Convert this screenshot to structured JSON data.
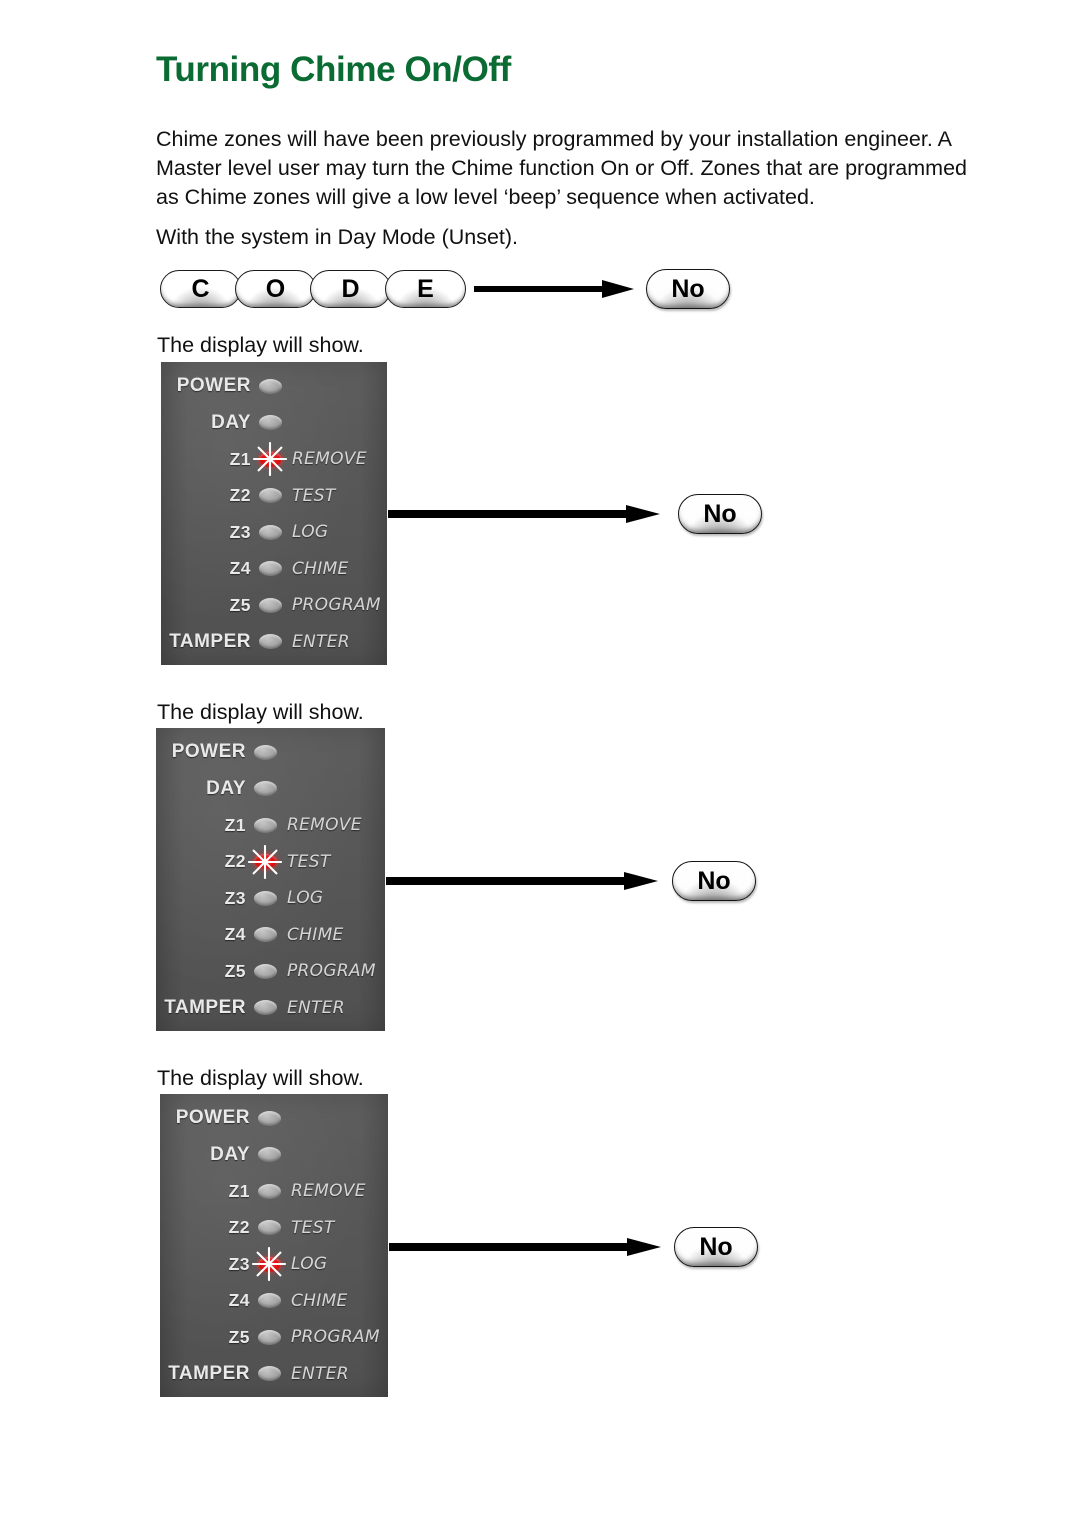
{
  "document": {
    "title": "Turning Chime On/Off",
    "title_color": "#0a6b33",
    "paragraphs": {
      "intro": "Chime zones will have been previously programmed by your installation engineer. A Master level user may turn the Chime function On or Off. Zones that are programmed as Chime zones will give a low level ‘beep’ sequence when activated.",
      "day_mode": "With the system in Day Mode (Unset)."
    },
    "captions": {
      "display_1": "The display will show.",
      "display_2": "The display will show.",
      "display_3": "The display will show."
    }
  },
  "keys": {
    "code_sequence": [
      "C",
      "O",
      "D",
      "E"
    ],
    "no_label": "No"
  },
  "panel_colors": {
    "background": "#575757",
    "label": "#e9e9e9",
    "function_label": "#d6d6d6",
    "led_off": "#a9a9a9",
    "led_on": "#e81414"
  },
  "panels": [
    {
      "id": "panel-1",
      "lit_zone": "Z1",
      "rows": [
        {
          "left": "POWER",
          "right": "",
          "lit": false
        },
        {
          "left": "DAY",
          "right": "",
          "lit": false
        },
        {
          "left": "Z1",
          "right": "REMOVE",
          "lit": true
        },
        {
          "left": "Z2",
          "right": "TEST",
          "lit": false
        },
        {
          "left": "Z3",
          "right": "LOG",
          "lit": false
        },
        {
          "left": "Z4",
          "right": "CHIME",
          "lit": false
        },
        {
          "left": "Z5",
          "right": "PROGRAM",
          "lit": false
        },
        {
          "left": "TAMPER",
          "right": "ENTER",
          "lit": false
        }
      ],
      "arrow_to": "No"
    },
    {
      "id": "panel-2",
      "lit_zone": "Z2",
      "rows": [
        {
          "left": "POWER",
          "right": "",
          "lit": false
        },
        {
          "left": "DAY",
          "right": "",
          "lit": false
        },
        {
          "left": "Z1",
          "right": "REMOVE",
          "lit": false
        },
        {
          "left": "Z2",
          "right": "TEST",
          "lit": true
        },
        {
          "left": "Z3",
          "right": "LOG",
          "lit": false
        },
        {
          "left": "Z4",
          "right": "CHIME",
          "lit": false
        },
        {
          "left": "Z5",
          "right": "PROGRAM",
          "lit": false
        },
        {
          "left": "TAMPER",
          "right": "ENTER",
          "lit": false
        }
      ],
      "arrow_to": "No"
    },
    {
      "id": "panel-3",
      "lit_zone": "Z3",
      "rows": [
        {
          "left": "POWER",
          "right": "",
          "lit": false
        },
        {
          "left": "DAY",
          "right": "",
          "lit": false
        },
        {
          "left": "Z1",
          "right": "REMOVE",
          "lit": false
        },
        {
          "left": "Z2",
          "right": "TEST",
          "lit": false
        },
        {
          "left": "Z3",
          "right": "LOG",
          "lit": true
        },
        {
          "left": "Z4",
          "right": "CHIME",
          "lit": false
        },
        {
          "left": "Z5",
          "right": "PROGRAM",
          "lit": false
        },
        {
          "left": "TAMPER",
          "right": "ENTER",
          "lit": false
        }
      ],
      "arrow_to": "No"
    }
  ]
}
